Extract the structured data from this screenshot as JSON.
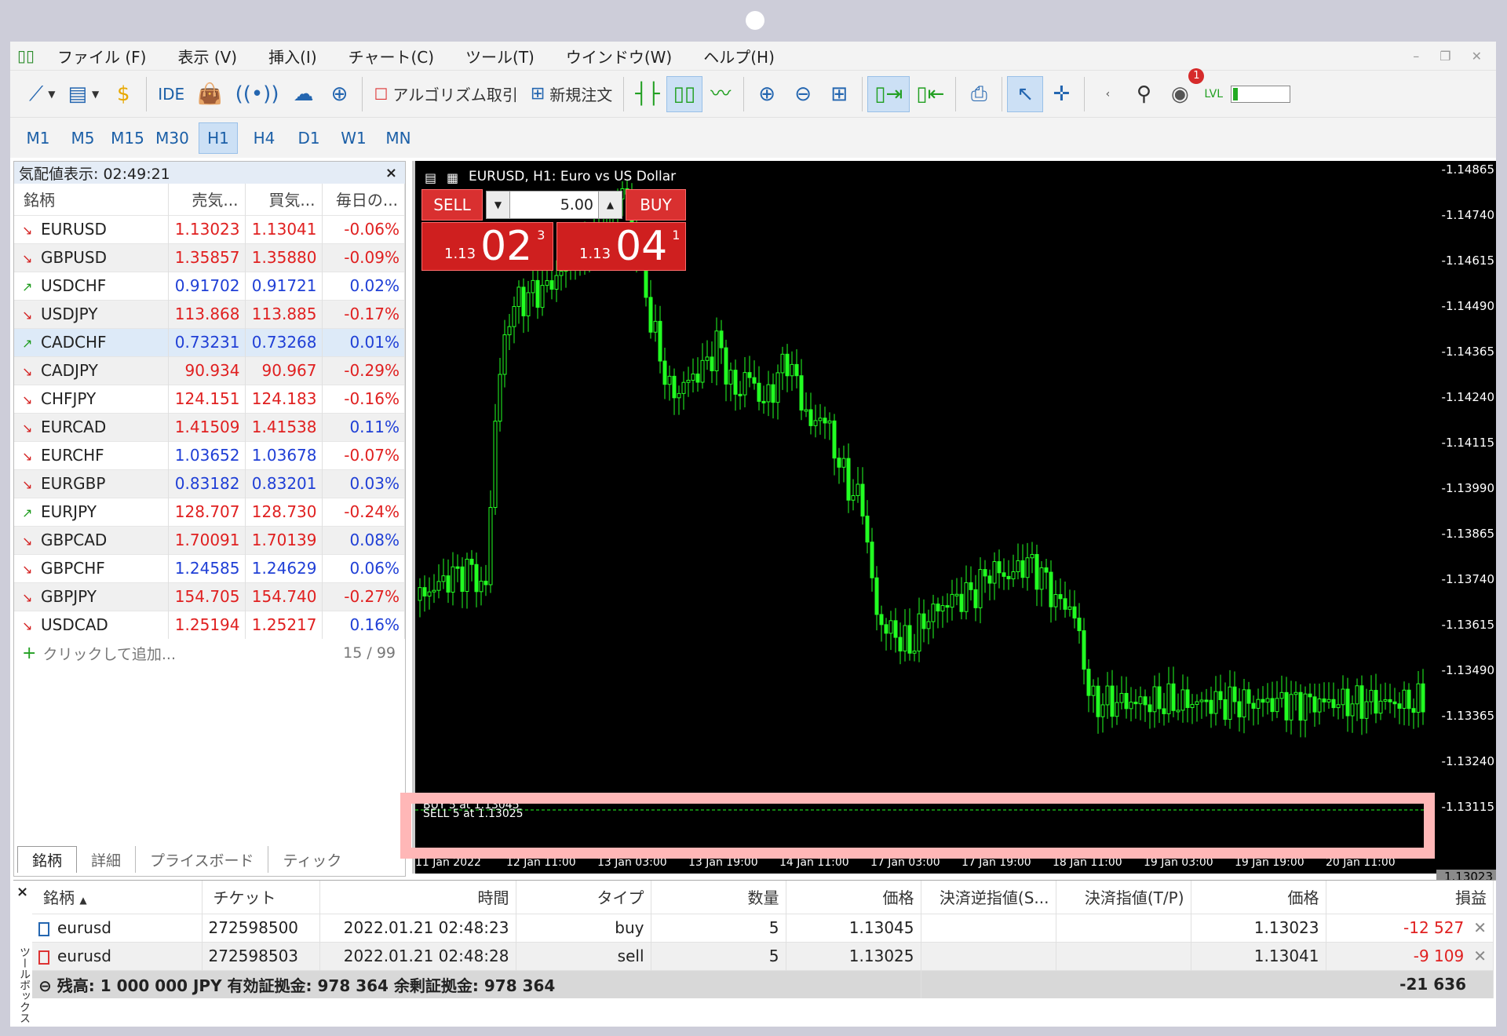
{
  "menu": {
    "items": [
      "ファイル (F)",
      "表示 (V)",
      "挿入(I)",
      "チャート(C)",
      "ツール(T)",
      "ウインドウ(W)",
      "ヘルプ(H)"
    ]
  },
  "toolbar": {
    "ide_label": "IDE",
    "algo_label": "アルゴリズム取引",
    "neworder_label": "新規注文",
    "notification_count": "1",
    "lvl_label": "LVL"
  },
  "timeframes": [
    "M1",
    "M5",
    "M15",
    "M30",
    "H1",
    "H4",
    "D1",
    "W1",
    "MN"
  ],
  "active_timeframe": "H1",
  "market_watch": {
    "title": "気配値表示: 02:49:21",
    "close": "×",
    "headers": [
      "銘柄",
      "売気...",
      "買気...",
      "毎日の..."
    ],
    "rows": [
      {
        "dir": "down",
        "symbol": "EURUSD",
        "bid": "1.13023",
        "ask": "1.13041",
        "change": "-0.06%",
        "color": "red"
      },
      {
        "dir": "down",
        "symbol": "GBPUSD",
        "bid": "1.35857",
        "ask": "1.35880",
        "change": "-0.09%",
        "color": "red"
      },
      {
        "dir": "up",
        "symbol": "USDCHF",
        "bid": "0.91702",
        "ask": "0.91721",
        "change": "0.02%",
        "color": "blue"
      },
      {
        "dir": "down",
        "symbol": "USDJPY",
        "bid": "113.868",
        "ask": "113.885",
        "change": "-0.17%",
        "color": "red"
      },
      {
        "dir": "up",
        "symbol": "CADCHF",
        "bid": "0.73231",
        "ask": "0.73268",
        "change": "0.01%",
        "color": "blue"
      },
      {
        "dir": "down",
        "symbol": "CADJPY",
        "bid": "90.934",
        "ask": "90.967",
        "change": "-0.29%",
        "color": "red"
      },
      {
        "dir": "down",
        "symbol": "CHFJPY",
        "bid": "124.151",
        "ask": "124.183",
        "change": "-0.16%",
        "color": "red"
      },
      {
        "dir": "down",
        "symbol": "EURCAD",
        "bid": "1.41509",
        "ask": "1.41538",
        "change": "0.11%",
        "color": "red"
      },
      {
        "dir": "down",
        "symbol": "EURCHF",
        "bid": "1.03652",
        "ask": "1.03678",
        "change": "-0.07%",
        "color": "blue"
      },
      {
        "dir": "down",
        "symbol": "EURGBP",
        "bid": "0.83182",
        "ask": "0.83201",
        "change": "0.03%",
        "color": "blue"
      },
      {
        "dir": "up",
        "symbol": "EURJPY",
        "bid": "128.707",
        "ask": "128.730",
        "change": "-0.24%",
        "color": "red"
      },
      {
        "dir": "down",
        "symbol": "GBPCAD",
        "bid": "1.70091",
        "ask": "1.70139",
        "change": "0.08%",
        "color": "red"
      },
      {
        "dir": "down",
        "symbol": "GBPCHF",
        "bid": "1.24585",
        "ask": "1.24629",
        "change": "0.06%",
        "color": "blue"
      },
      {
        "dir": "down",
        "symbol": "GBPJPY",
        "bid": "154.705",
        "ask": "154.740",
        "change": "-0.27%",
        "color": "red"
      },
      {
        "dir": "down",
        "symbol": "USDCAD",
        "bid": "1.25194",
        "ask": "1.25217",
        "change": "0.16%",
        "color": "red"
      }
    ],
    "add_label": "クリックして追加...",
    "count": "15 / 99",
    "tabs": [
      "銘柄",
      "詳細",
      "プライスボード",
      "ティック"
    ]
  },
  "chart": {
    "title": "EURUSD, H1:  Euro vs US Dollar",
    "sell_label": "SELL",
    "buy_label": "BUY",
    "volume": "5.00",
    "sell_price_small": "1.13",
    "sell_price_big": "02",
    "sell_price_sup": "3",
    "buy_price_small": "1.13",
    "buy_price_big": "04",
    "buy_price_sup": "1",
    "y_ticks": [
      "1.14865",
      "1.14740",
      "1.14615",
      "1.14490",
      "1.14365",
      "1.14240",
      "1.14115",
      "1.13990",
      "1.13865",
      "1.13740",
      "1.13615",
      "1.13490",
      "1.13365",
      "1.13240",
      "1.13115"
    ],
    "current_price": "1.13023",
    "x_ticks": [
      "11 Jan 2022",
      "12 Jan 11:00",
      "13 Jan 03:00",
      "13 Jan 19:00",
      "14 Jan 11:00",
      "17 Jan 03:00",
      "17 Jan 19:00",
      "18 Jan 11:00",
      "19 Jan 03:00",
      "19 Jan 19:00",
      "20 Jan 11:00"
    ],
    "buy_line_label": "BUY 5 at 1.13045",
    "sell_line_label": "SELL 5 at 1.13025"
  },
  "trades": {
    "headers": [
      "銘柄",
      "チケット",
      "時間",
      "タイプ",
      "数量",
      "価格",
      "決済逆指値(S...",
      "決済指値(T/P)",
      "価格",
      "損益"
    ],
    "rows": [
      {
        "symbol": "eurusd",
        "ticket": "272598500",
        "time": "2022.01.21 02:48:23",
        "type": "buy",
        "volume": "5",
        "price": "1.13045",
        "sl": "",
        "tp": "",
        "cur_price": "1.13023",
        "profit": "-12 527"
      },
      {
        "symbol": "eurusd",
        "ticket": "272598503",
        "time": "2022.01.21 02:48:28",
        "type": "sell",
        "volume": "5",
        "price": "1.13025",
        "sl": "",
        "tp": "",
        "cur_price": "1.13041",
        "profit": "-9 109"
      }
    ],
    "summary": "残高: 1 000 000 JPY  有効証拠金: 978 364  余剰証拠金: 978 364",
    "total_profit": "-21 636",
    "side_label": "ツールボックス"
  },
  "colors": {
    "candle": "#22ff22",
    "highlight": "#ffb7b7",
    "sell_red": "#d93030"
  }
}
